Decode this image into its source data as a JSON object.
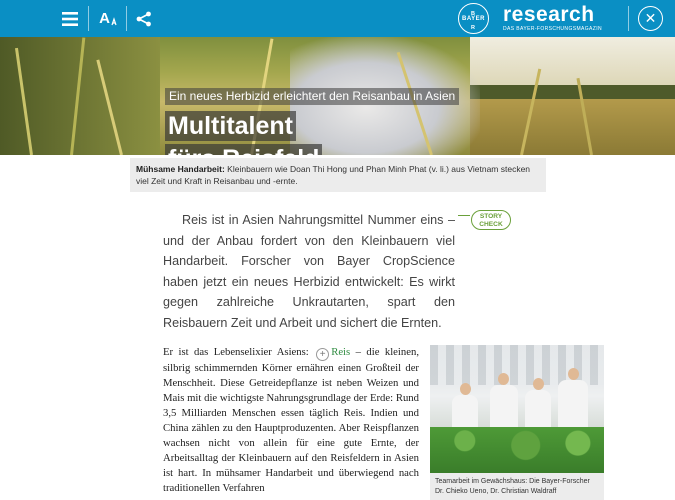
{
  "topbar": {
    "brand_title": "research",
    "brand_subtitle": "DAS BAYER-FORSCHUNGSMAGAZIN",
    "bayer_logo_text": "BAYER",
    "font_icon_label": "A",
    "close_label": "✕"
  },
  "hero": {
    "kicker": "Ein neues Herbizid erleichtert den Reisanbau in Asien",
    "title_line1": "Multitalent",
    "title_line2": "fürs Reisfeld"
  },
  "caption": {
    "label": "Mühsame Handarbeit:",
    "text": "Kleinbauern wie Doan Thi Hong und Phan Minh Phat (v. li.) aus Vietnam stecken viel Zeit und Kraft in Reisanbau und -ernte."
  },
  "story_check": {
    "line1": "STORY",
    "line2": "CHECK"
  },
  "lead": {
    "text": "Reis ist in Asien Nahrungsmittel Nummer eins – und der Anbau fordert von den Kleinbauern viel Handarbeit. Forscher von Bayer CropScience haben jetzt ein neues Herbizid entwickelt: Es wirkt gegen zahlreiche Unkrautarten, spart den Reisbauern Zeit und Arbeit und sichert die Ernten."
  },
  "body": {
    "before_link": "Er ist das Lebenselixier Asiens:",
    "link": "Reis",
    "after_link": "– die kleinen, silbrig schimmernden Körner ernähren einen Großteil der Menschheit. Diese Getreidepflanze ist neben Weizen und Mais mit die wichtigste Nahrungsgrundlage der Erde: Rund 3,5 Milliarden Menschen essen täglich Reis. Indien und China zählen zu den Hauptproduzenten. Aber Reispflanzen wachsen nicht von allein für eine gute Ernte, der Arbeitsalltag der Kleinbauern auf den Reisfeldern in Asien ist hart. In mühsamer Handarbeit und überwiegend nach traditionellen Verfahren"
  },
  "side_caption": {
    "text": "Teamarbeit im Gewächshaus: Die Bayer-Forscher Dr. Chieko Ueno, Dr. Christian Waldraff"
  },
  "colors": {
    "topbar": "#0a8fc4",
    "story_check": "#6aa03a",
    "link": "#2e8b40"
  }
}
